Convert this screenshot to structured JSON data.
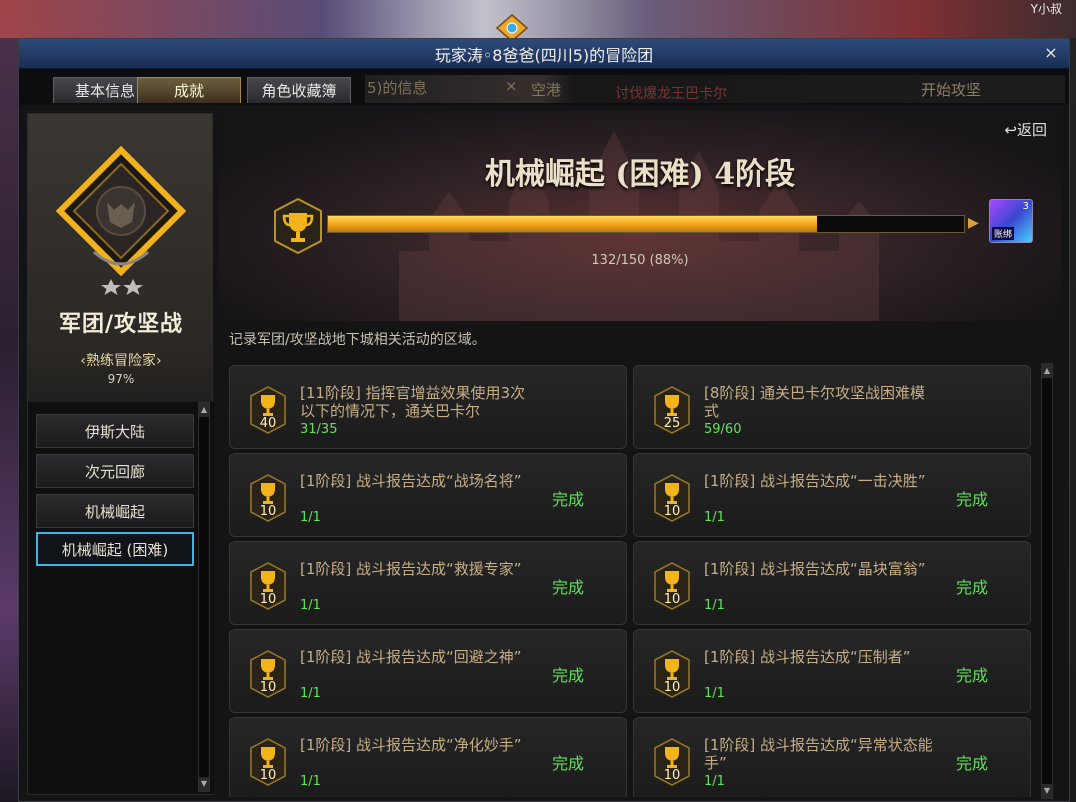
{
  "window": {
    "title": "玩家涛◦8爸爸(四川5)的冒险团",
    "close_label": "×"
  },
  "background": {
    "top_right_text": "Y小叔",
    "ghost_texts": [
      "5)的信息",
      "×",
      "空港",
      "讨伐爆龙王巴卡尔",
      "开始攻坚"
    ]
  },
  "tabs": [
    {
      "label": "基本信息",
      "active": false
    },
    {
      "label": "成就",
      "active": true
    },
    {
      "label": "角色收藏簿",
      "active": false
    }
  ],
  "category": {
    "title": "军团/攻坚战",
    "rank_label": "‹熟练冒险家›",
    "rank_percent": "97%",
    "stars": 2
  },
  "nav": {
    "items": [
      {
        "label": "伊斯大陆",
        "active": false
      },
      {
        "label": "次元回廊",
        "active": false
      },
      {
        "label": "机械崛起",
        "active": false
      },
      {
        "label": "机械崛起 (困难)",
        "active": true
      }
    ]
  },
  "stage": {
    "back_label": "↩返回",
    "title": "机械崛起 (困难) 4阶段",
    "progress_current": 132,
    "progress_total": 150,
    "progress_text": "132/150 (88%)",
    "reward": {
      "quantity": "3",
      "tag": "账绑"
    }
  },
  "description": "记录军团/攻坚战地下城相关活动的区域。",
  "achievements": [
    {
      "points": "40",
      "text": "[11阶段] 指挥官增益效果使用3次以下的情况下，通关巴卡尔",
      "progress": "31/35",
      "status": ""
    },
    {
      "points": "25",
      "text": "[8阶段] 通关巴卡尔攻坚战困难模式",
      "progress": "59/60",
      "status": ""
    },
    {
      "points": "10",
      "text": "[1阶段] 战斗报告达成“战场名将”",
      "progress": "1/1",
      "status": "完成"
    },
    {
      "points": "10",
      "text": "[1阶段] 战斗报告达成“一击决胜”",
      "progress": "1/1",
      "status": "完成"
    },
    {
      "points": "10",
      "text": "[1阶段] 战斗报告达成“救援专家”",
      "progress": "1/1",
      "status": "完成"
    },
    {
      "points": "10",
      "text": "[1阶段] 战斗报告达成“晶块富翁”",
      "progress": "1/1",
      "status": "完成"
    },
    {
      "points": "10",
      "text": "[1阶段] 战斗报告达成“回避之神”",
      "progress": "1/1",
      "status": "完成"
    },
    {
      "points": "10",
      "text": "[1阶段] 战斗报告达成“压制者”",
      "progress": "1/1",
      "status": "完成"
    },
    {
      "points": "10",
      "text": "[1阶段] 战斗报告达成“净化妙手”",
      "progress": "1/1",
      "status": "完成"
    },
    {
      "points": "10",
      "text": "[1阶段] 战斗报告达成“异常状态能手”",
      "progress": "1/1",
      "status": "完成"
    }
  ],
  "colors": {
    "accent_gold": "#f0a21a",
    "complete_green": "#5fe05a",
    "selected_border": "#3fb3e8",
    "titlebar_blue": "#2d4a7a"
  }
}
